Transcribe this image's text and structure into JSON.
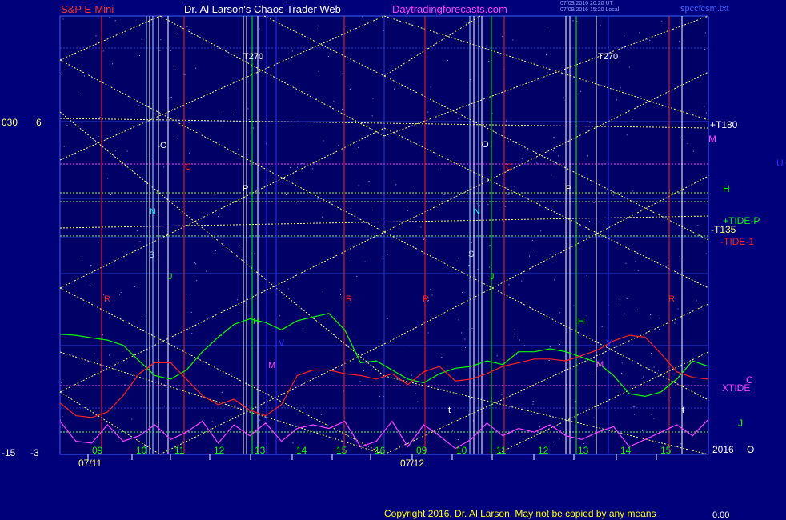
{
  "header": {
    "instrument": "S&P E-Mini",
    "author": "Dr. Al Larson's Chaos Trader Web",
    "site": "Daytradingforecasts.com",
    "stamp_line1": "07/09/2016 20:20 UT",
    "stamp_line2": "07/09/2016 15:20 Local",
    "file": "spccfcsm.txt"
  },
  "footer": {
    "copyright": "Copyright 2016, Dr. Al Larson. May not be copied by any means",
    "counter": "0.00"
  },
  "colors": {
    "background": "#00007a",
    "plot_bg": "#000066",
    "green_curve": "#00ff00",
    "red_curve": "#ff2020",
    "magenta_curve": "#ff40ff",
    "yellow_lines": "#ffff66",
    "white_text": "#ffffff"
  },
  "chart_data": {
    "type": "line",
    "left_scale_labels": [
      {
        "left": "030",
        "right": "6"
      },
      {
        "left": "-15",
        "right": "-3"
      }
    ],
    "x_date_labels": [
      "07/11",
      "07/12"
    ],
    "x_hour_labels": [
      "09",
      "10",
      "11",
      "12",
      "13",
      "14",
      "15",
      "16",
      "09",
      "10",
      "11",
      "12",
      "13",
      "14",
      "15"
    ],
    "right_labels": [
      "+T180",
      "M",
      "U",
      "H",
      "+TIDE-P",
      "-T135",
      "-TIDE-1",
      "XTIDE",
      "C",
      "J",
      "2016",
      "O"
    ],
    "marker_labels": [
      "T270",
      "T270",
      "O",
      "O",
      "C",
      "C",
      "P",
      "P",
      "N",
      "N",
      "S",
      "S",
      "J",
      "J",
      "R",
      "R",
      "R",
      "R",
      "H",
      "H",
      "M",
      "M",
      "V",
      "V",
      "t",
      "t"
    ],
    "series": [
      {
        "name": "+TIDE-P",
        "color": "#00ff00",
        "values": [
          0.18,
          0.15,
          0.08,
          0.02,
          -0.12,
          -0.55,
          -0.95,
          -1.05,
          -0.8,
          -0.3,
          0.1,
          0.45,
          0.6,
          0.5,
          0.3,
          0.55,
          0.65,
          0.75,
          0.3,
          -0.6,
          -0.55,
          -0.8,
          -1.05,
          -1.15,
          -0.9,
          -0.75,
          -0.7,
          -0.55,
          -0.65,
          -0.3,
          -0.3,
          -0.22,
          -0.3,
          -0.45,
          -0.6,
          -0.95,
          -1.45,
          -1.52,
          -1.4,
          -1.05,
          -0.55,
          -0.7
        ]
      },
      {
        "name": "-TIDE-1",
        "color": "#ff2020",
        "values": [
          -1.7,
          -2.05,
          -2.1,
          -1.95,
          -1.5,
          -0.9,
          -0.6,
          -0.6,
          -1.05,
          -1.5,
          -1.75,
          -1.6,
          -1.9,
          -2.05,
          -1.75,
          -0.95,
          -0.8,
          -0.8,
          -0.9,
          -0.95,
          -1.05,
          -0.9,
          -1.2,
          -0.85,
          -0.7,
          -1.1,
          -1.05,
          -0.9,
          -0.7,
          -0.6,
          -0.5,
          -0.5,
          -0.55,
          -0.4,
          -0.25,
          0.0,
          0.15,
          0.1,
          -0.35,
          -0.85,
          -1.0,
          -1.05
        ]
      },
      {
        "name": "XTIDE",
        "color": "#ff40ff",
        "values": [
          -2.2,
          -2.75,
          -2.8,
          -2.3,
          -2.75,
          -2.6,
          -2.3,
          -2.7,
          -2.5,
          -2.2,
          -2.8,
          -2.3,
          -2.6,
          -2.25,
          -2.75,
          -2.4,
          -2.3,
          -2.4,
          -2.2,
          -2.9,
          -2.75,
          -2.2,
          -2.9,
          -2.3,
          -2.6,
          -2.95,
          -2.7,
          -2.25,
          -2.6,
          -2.4,
          -2.5,
          -2.3,
          -2.6,
          -2.7,
          -2.5,
          -2.35,
          -2.9,
          -2.7,
          -2.5,
          -2.3,
          -2.6,
          -2.15
        ]
      }
    ]
  }
}
